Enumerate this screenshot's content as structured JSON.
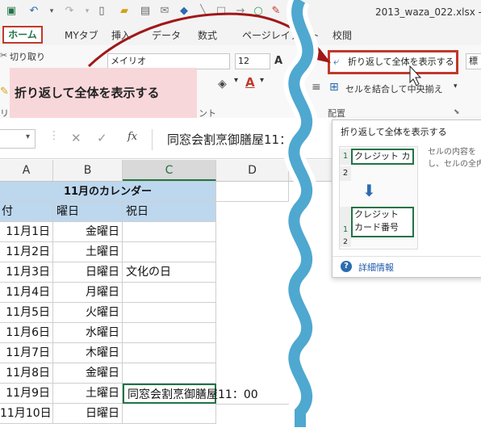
{
  "title_bar": {
    "filename": "2013_waza_022.xlsx -"
  },
  "tabs": [
    "ホーム",
    "MYタブ",
    "挿入",
    "データ",
    "数式",
    "ページレイアウト",
    "校閲"
  ],
  "ribbon": {
    "cut_label": "切り取り",
    "font_name": "メイリオ",
    "font_size": "12",
    "wrap_text_label": "折り返して全体を表示する",
    "merge_label": "セルを結合して中央揃え",
    "alignment_group": "配置",
    "font_group_tail": "ント",
    "clip_group_tail": "リ",
    "style_box": "標"
  },
  "callout": {
    "text": "折り返して全体を表示する"
  },
  "formula_bar": {
    "cancel": "✕",
    "enter": "✓",
    "fx": "fx",
    "content": "同窓会割烹御膳屋11："
  },
  "columns": [
    "A",
    "B",
    "C",
    "D"
  ],
  "sheet": {
    "title": "11月のカレンダー",
    "headers": [
      "付",
      "曜日",
      "祝日"
    ],
    "rows": [
      {
        "date": "11月1日",
        "day": "金曜日",
        "holiday": ""
      },
      {
        "date": "11月2日",
        "day": "土曜日",
        "holiday": ""
      },
      {
        "date": "11月3日",
        "day": "日曜日",
        "holiday": "文化の日"
      },
      {
        "date": "11月4日",
        "day": "月曜日",
        "holiday": ""
      },
      {
        "date": "11月5日",
        "day": "火曜日",
        "holiday": ""
      },
      {
        "date": "11月6日",
        "day": "水曜日",
        "holiday": ""
      },
      {
        "date": "11月7日",
        "day": "木曜日",
        "holiday": ""
      },
      {
        "date": "11月8日",
        "day": "金曜日",
        "holiday": ""
      },
      {
        "date": "11月9日",
        "day": "土曜日",
        "holiday": "同窓会割烹御膳屋11：00"
      },
      {
        "date": "11月10日",
        "day": "日曜日",
        "holiday": ""
      }
    ]
  },
  "tooltip": {
    "title": "折り返して全体を表示する",
    "desc": "セルの内容をし、セルの全内",
    "ex_before": "クレジット カ",
    "ex_after_line1": "クレジット",
    "ex_after_line2": "カード番号",
    "row1": "1",
    "row2": "2",
    "more_info": "詳細情報"
  },
  "colors": {
    "excel_green": "#217346",
    "highlight_red": "#c0392b",
    "callout_pink": "#f8d7da",
    "header_blue": "#bdd7ee",
    "wave_blue": "#4fa8d0"
  }
}
